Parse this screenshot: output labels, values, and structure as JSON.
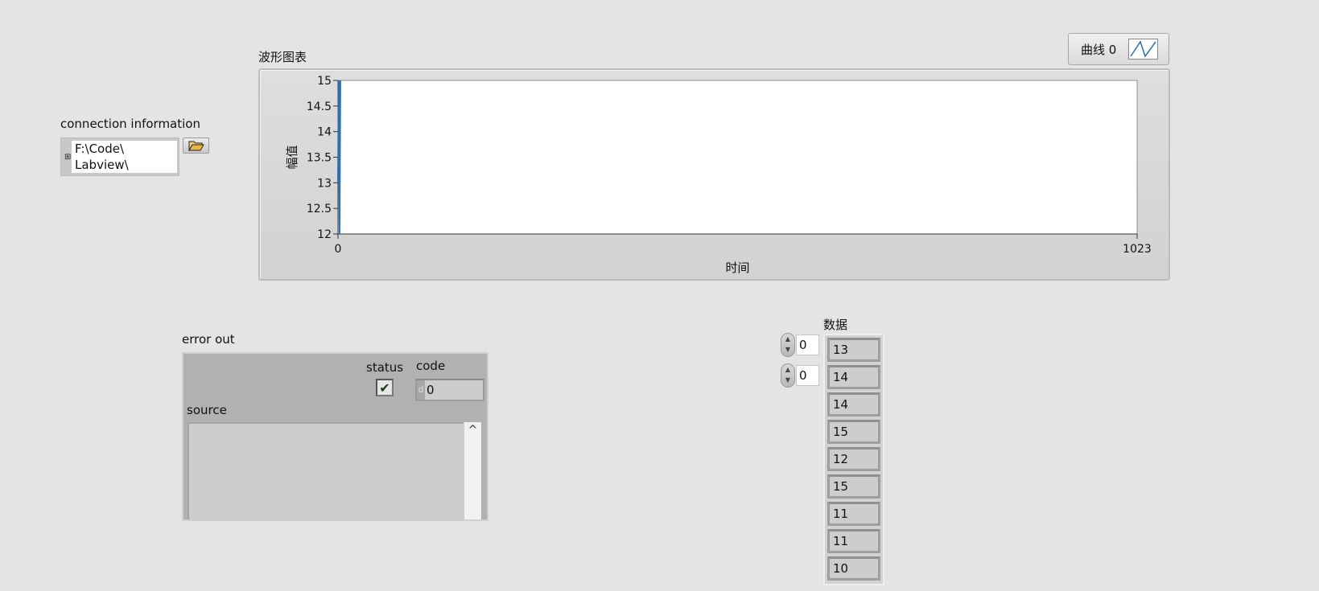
{
  "path_control": {
    "label": "connection information",
    "value": "F:\\Code\\\nLabview\\",
    "glyph": "⊞",
    "browse_icon": "folder-open-icon"
  },
  "waveform_chart": {
    "label": "波形图表",
    "legend_label": "曲线 0",
    "legend_icon": "line-plot-icon"
  },
  "chart_data": {
    "type": "line",
    "title": "波形图表",
    "xlabel": "时间",
    "ylabel": "幅值",
    "xlim": [
      0,
      1023
    ],
    "ylim": [
      12,
      15
    ],
    "x_ticks": [
      "0",
      "1023"
    ],
    "y_ticks": [
      "15",
      "14.5",
      "14",
      "13.5",
      "13",
      "12.5",
      "12"
    ],
    "series": [
      {
        "name": "曲线 0",
        "color": "#2a70b8",
        "x": [
          0,
          1,
          2,
          3
        ],
        "y": [
          13,
          15,
          12,
          15
        ]
      }
    ],
    "grid": false,
    "legend": "top-right"
  },
  "error_out": {
    "label": "error out",
    "status_label": "status",
    "status_mark": "✔",
    "code_label": "code",
    "code_radix": "d",
    "code_value": "0",
    "source_label": "source",
    "source_value": "",
    "scroll_up": "^"
  },
  "data_array": {
    "label": "数据",
    "index_row": "0",
    "index_col": "0",
    "values": [
      "13",
      "14",
      "14",
      "15",
      "12",
      "15",
      "11",
      "11",
      "10"
    ]
  },
  "colors": {
    "panel_bg": "#e4e4e4",
    "plot_bg": "#ffffff",
    "plot_line": "#2a70b8"
  }
}
